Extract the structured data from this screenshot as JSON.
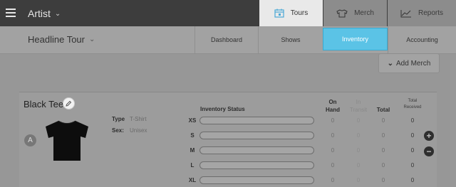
{
  "topbar": {
    "artist_label": "Artist",
    "tabs": [
      {
        "label": "Tours",
        "icon": "calendar-icon",
        "active": true
      },
      {
        "label": "Merch",
        "icon": "tshirt-icon",
        "active": false
      },
      {
        "label": "Reports",
        "icon": "chart-icon",
        "active": false
      }
    ]
  },
  "subbar": {
    "tour_name": "Headline Tour",
    "tabs": [
      {
        "label": "Dashboard",
        "active": false
      },
      {
        "label": "Shows",
        "active": false
      },
      {
        "label": "Inventory",
        "active": true
      },
      {
        "label": "Accounting",
        "active": false
      }
    ]
  },
  "add_merch_label": "Add Merch",
  "product": {
    "title": "Black Tee",
    "avatar_letter": "A",
    "type_label": "Type",
    "type_value": "T-Shirt",
    "sex_label": "Sex:",
    "sex_value": "Unisex"
  },
  "inventory": {
    "status_header": "Inventory Status",
    "col_on_hand": "On Hand",
    "col_in_transit": "In Transit",
    "col_total": "Total",
    "col_total_received": "Total Received",
    "rows": [
      {
        "size": "XS",
        "on_hand": "0",
        "in_transit": "0",
        "total": "0",
        "received": "0"
      },
      {
        "size": "S",
        "on_hand": "0",
        "in_transit": "0",
        "total": "0",
        "received": "0"
      },
      {
        "size": "M",
        "on_hand": "0",
        "in_transit": "0",
        "total": "0",
        "received": "0"
      },
      {
        "size": "L",
        "on_hand": "0",
        "in_transit": "0",
        "total": "0",
        "received": "0"
      },
      {
        "size": "XL",
        "on_hand": "0",
        "in_transit": "0",
        "total": "0",
        "received": "0"
      }
    ]
  },
  "colors": {
    "accent": "#5bc3e6",
    "topbar": "#3d3d3d"
  }
}
